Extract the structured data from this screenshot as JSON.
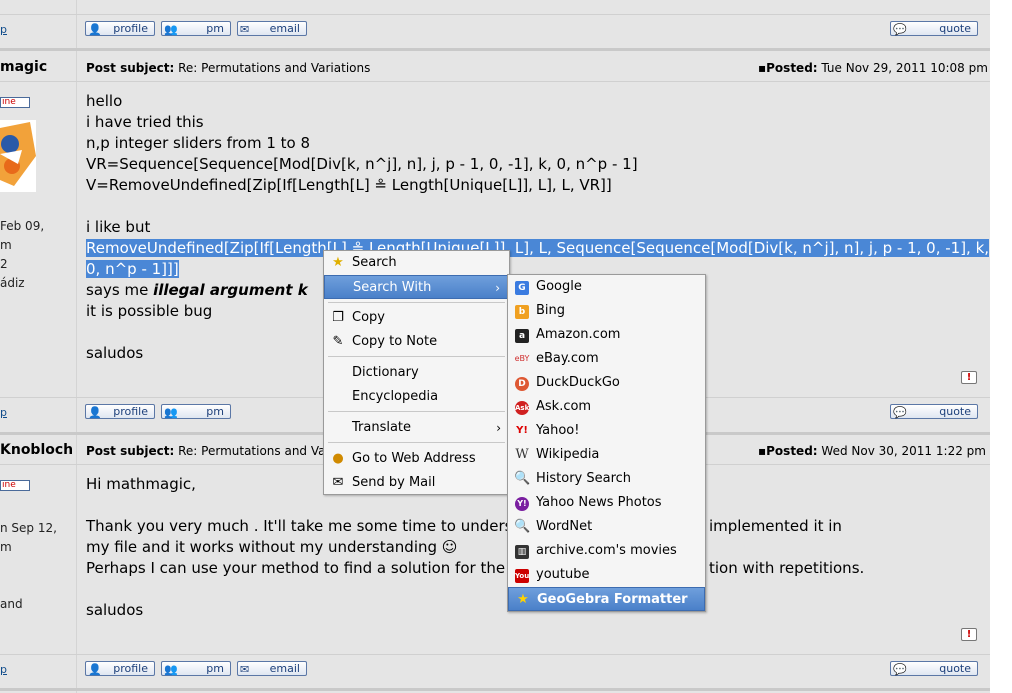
{
  "post1_footer": {
    "link": "p",
    "buttons": {
      "profile": "profile",
      "pm": "pm",
      "email": "email",
      "quote": "quote"
    }
  },
  "post2": {
    "author": "magic",
    "online": "ine",
    "joined": "Feb 09,",
    "info2": "m",
    "info3": "2",
    "location": "ádiz",
    "subject_label": "Post subject:",
    "subject": "Re: Permutations and Variations",
    "posted_label": "Posted:",
    "posted": "Tue Nov 29, 2011 10:08 pm",
    "lines": [
      "hello",
      "i have tried this",
      "n,p integer sliders from 1 to 8",
      "VR=Sequence[Sequence[Mod[Div[k, n^j], n], j, p - 1, 0, -1], k, 0, n^p - 1]",
      "V=RemoveUndefined[Zip[If[Length[L] ≗ Length[Unique[L]], L], L, VR]]",
      "i like but",
      "RemoveUndefined[Zip[If[Length[L] ≗ Length[Unique[L]], L], L, Sequence[Sequence[Mod[Div[k, n^j], n], j, p - 1, 0, -1], k,",
      "0, n^p - 1]]]",
      "says me ",
      "illegal argument k",
      "it is possible bug",
      "saludos"
    ],
    "footer_link": "p",
    "buttons": {
      "profile": "profile",
      "pm": "pm",
      "quote": "quote"
    },
    "report": "!"
  },
  "post3": {
    "author": "Knobloch",
    "online": "ine",
    "joined": "n Sep 12,",
    "info2": "m",
    "info3": "and",
    "subject_label": "Post subject:",
    "subject": "Re: Permutations and Var",
    "posted_label": "Posted:",
    "posted": "Wed Nov 30, 2011 1:22 pm",
    "lines": [
      "Hi mathmagic,",
      "Thank you very much . It'll take me some time to underst",
      "implemented it in",
      "my file and it works without my understanding",
      "Perhaps I can use your method to find a solution for the l",
      "tion with repetitions.",
      "saludos"
    ],
    "footer_link": "p",
    "buttons": {
      "profile": "profile",
      "pm": "pm",
      "email": "email",
      "quote": "quote"
    },
    "report": "!"
  },
  "context_menu": {
    "items": [
      "Search",
      "Search With",
      "Copy",
      "Copy to Note",
      "Dictionary",
      "Encyclopedia",
      "Translate",
      "Go to Web Address",
      "Send by Mail"
    ]
  },
  "submenu": {
    "items": [
      "Google",
      "Bing",
      "Amazon.com",
      "eBay.com",
      "DuckDuckGo",
      "Ask.com",
      "Yahoo!",
      "Wikipedia",
      "History Search",
      "Yahoo News Photos",
      "WordNet",
      "archive.com's movies",
      "youtube",
      "GeoGebra Formatter"
    ]
  },
  "colors": {
    "selection": "#4a87d6",
    "menu_active": "#4a80c9",
    "link": "#104c8b"
  }
}
